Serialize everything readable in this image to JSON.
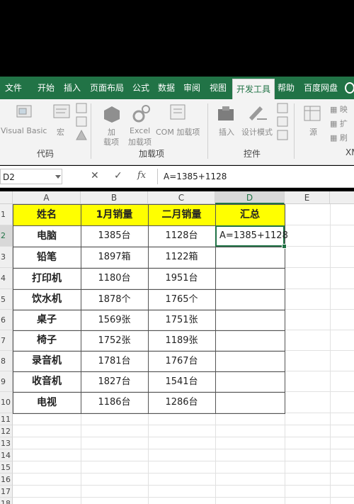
{
  "ribbon_tabs": [
    "文件",
    "开始",
    "插入",
    "页面布局",
    "公式",
    "数据",
    "审阅",
    "视图",
    "开发工具",
    "帮助",
    "百度网盘"
  ],
  "active_tab": "开发工具",
  "ribbon": {
    "code_group": {
      "label": "代码",
      "visual_basic": "Visual Basic",
      "macro": "宏"
    },
    "addins_group": {
      "label": "加载项",
      "addins_line1": "加",
      "addins_line2": "载项",
      "excel_addins_line1": "Excel",
      "excel_addins_line2": "加载项",
      "com_addins": "COM 加载项"
    },
    "controls_group": {
      "label": "控件",
      "insert": "插入",
      "design_mode": "设计模式"
    },
    "xml_group": {
      "label": "XM",
      "source": "源",
      "map_props": "映",
      "expand": "扩",
      "refresh": "刷"
    }
  },
  "formula_bar": {
    "name_box": "D2",
    "cancel": "✕",
    "enter": "✓",
    "fx": "fx",
    "formula": "A=1385+1128"
  },
  "columns": [
    "A",
    "B",
    "C",
    "D",
    "E"
  ],
  "rows": [
    "1",
    "2",
    "3",
    "4",
    "5",
    "6",
    "7",
    "8",
    "9",
    "10",
    "11",
    "12",
    "13",
    "14",
    "15",
    "16",
    "17",
    "18"
  ],
  "table": {
    "headers": [
      "姓名",
      "1月销量",
      "二月销量",
      "汇总"
    ],
    "rows": [
      [
        "电脑",
        "1385台",
        "1128台"
      ],
      [
        "铅笔",
        "1897箱",
        "1122箱"
      ],
      [
        "打印机",
        "1180台",
        "1951台"
      ],
      [
        "饮水机",
        "1878个",
        "1765个"
      ],
      [
        "桌子",
        "1569张",
        "1751张"
      ],
      [
        "椅子",
        "1752张",
        "1189张"
      ],
      [
        "录音机",
        "1781台",
        "1767台"
      ],
      [
        "收音机",
        "1827台",
        "1541台"
      ],
      [
        "电视",
        "1186台",
        "1286台"
      ]
    ],
    "editing_value": "A=1385+1128"
  },
  "colors": {
    "excel_green": "#217346",
    "header_fill": "#ffff00"
  }
}
